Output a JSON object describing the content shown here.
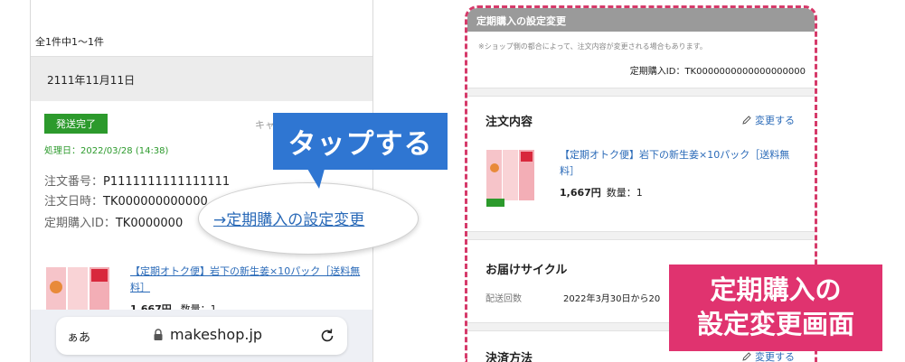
{
  "left": {
    "result_count": "全1件中1〜1件",
    "date": "2111年11月11日",
    "status_badge": "発送完了",
    "cancel_partial": "キャ",
    "processed_date": "処理日：2022/03/28 (14:38)",
    "order_no_label": "注文番号：",
    "order_no_value": "P1111111111111111",
    "order_date_label": "注文日時：",
    "order_date_value": "TK000000000000",
    "subscription_id_label": "定期購入ID：",
    "subscription_id_value": "TK0000000",
    "product_name": "【定期オトク便】岩下の新生姜×10パック［送料無料］",
    "product_price": "1,667円",
    "product_qty": "数量：1"
  },
  "browser": {
    "aa_label": "ぁあ",
    "url": "makeshop.jp",
    "lock_icon": "lock-icon",
    "reload_icon": "reload-icon"
  },
  "callout": {
    "tap_label": "タップする",
    "zoom_link": "→定期購入の設定変更"
  },
  "right": {
    "header_title": "定期購入の設定変更",
    "notice": "※ショップ側の都合によって、注文内容が変更される場合もあります。",
    "subscription_id": "定期購入ID：TK0000000000000000000",
    "order_section_title": "注文内容",
    "edit_label": "変更する",
    "product_name": "【定期オトク便】岩下の新生姜×10パック［送料無料］",
    "product_price": "1,667円",
    "product_qty": "数量：1",
    "cycle_section_title": "お届けサイクル",
    "delivery_count_label": "配送回数",
    "delivery_count_value": "2022年3月30日から20",
    "payment_section_title": "決済方法",
    "payment_edit_label": "変更する"
  },
  "overlay": {
    "line1": "定期購入の",
    "line2": "設定変更画面"
  },
  "colors": {
    "status_green": "#2c9a2c",
    "link_blue": "#2a6ab8",
    "callout_blue": "#2f76d2",
    "accent_pink": "#e0336f",
    "header_gray": "#9a9a9a"
  }
}
